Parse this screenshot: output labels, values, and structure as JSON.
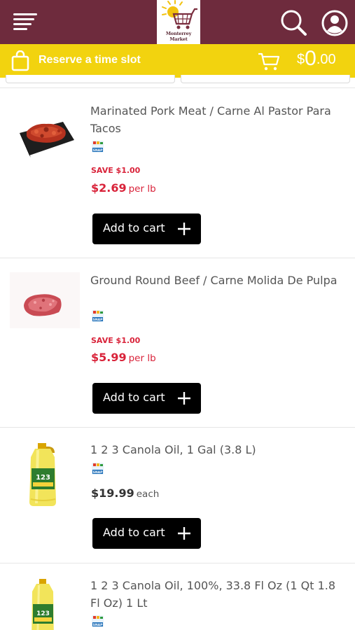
{
  "header": {
    "logo_text": "Monterrey Market"
  },
  "slot_bar": {
    "reserve_label": "Reserve a time slot",
    "cart_currency": "$",
    "cart_dollars": "0",
    "cart_cents": ".00"
  },
  "products": [
    {
      "name": "Marinated Pork Meat / Carne Al Pastor Para Tacos",
      "save": "SAVE $1.00",
      "price": "$2.69",
      "unit": "per lb",
      "button": "Add to cart"
    },
    {
      "name": "Ground Round Beef / Carne Molida De Pulpa",
      "save": "SAVE $1.00",
      "price": "$5.99",
      "unit": "per lb",
      "button": "Add to cart"
    },
    {
      "name": "1 2 3 Canola Oil, 1 Gal (3.8 L)",
      "price": "$19.99",
      "unit": "each",
      "button": "Add to cart"
    },
    {
      "name": "1 2 3 Canola Oil, 100%, 33.8 Fl Oz (1 Qt 1.8 Fl Oz) 1 Lt"
    }
  ],
  "colors": {
    "header_bg": "#6e2b3d",
    "slot_bar_bg": "#f2d30f",
    "sale_red": "#d9233a",
    "button_bg": "#000000"
  },
  "icons": [
    "menu-icon",
    "logo-cart-sun",
    "search-icon",
    "account-icon",
    "shopping-bag-icon",
    "cart-icon",
    "snap-ebt-icon",
    "plus-icon"
  ]
}
